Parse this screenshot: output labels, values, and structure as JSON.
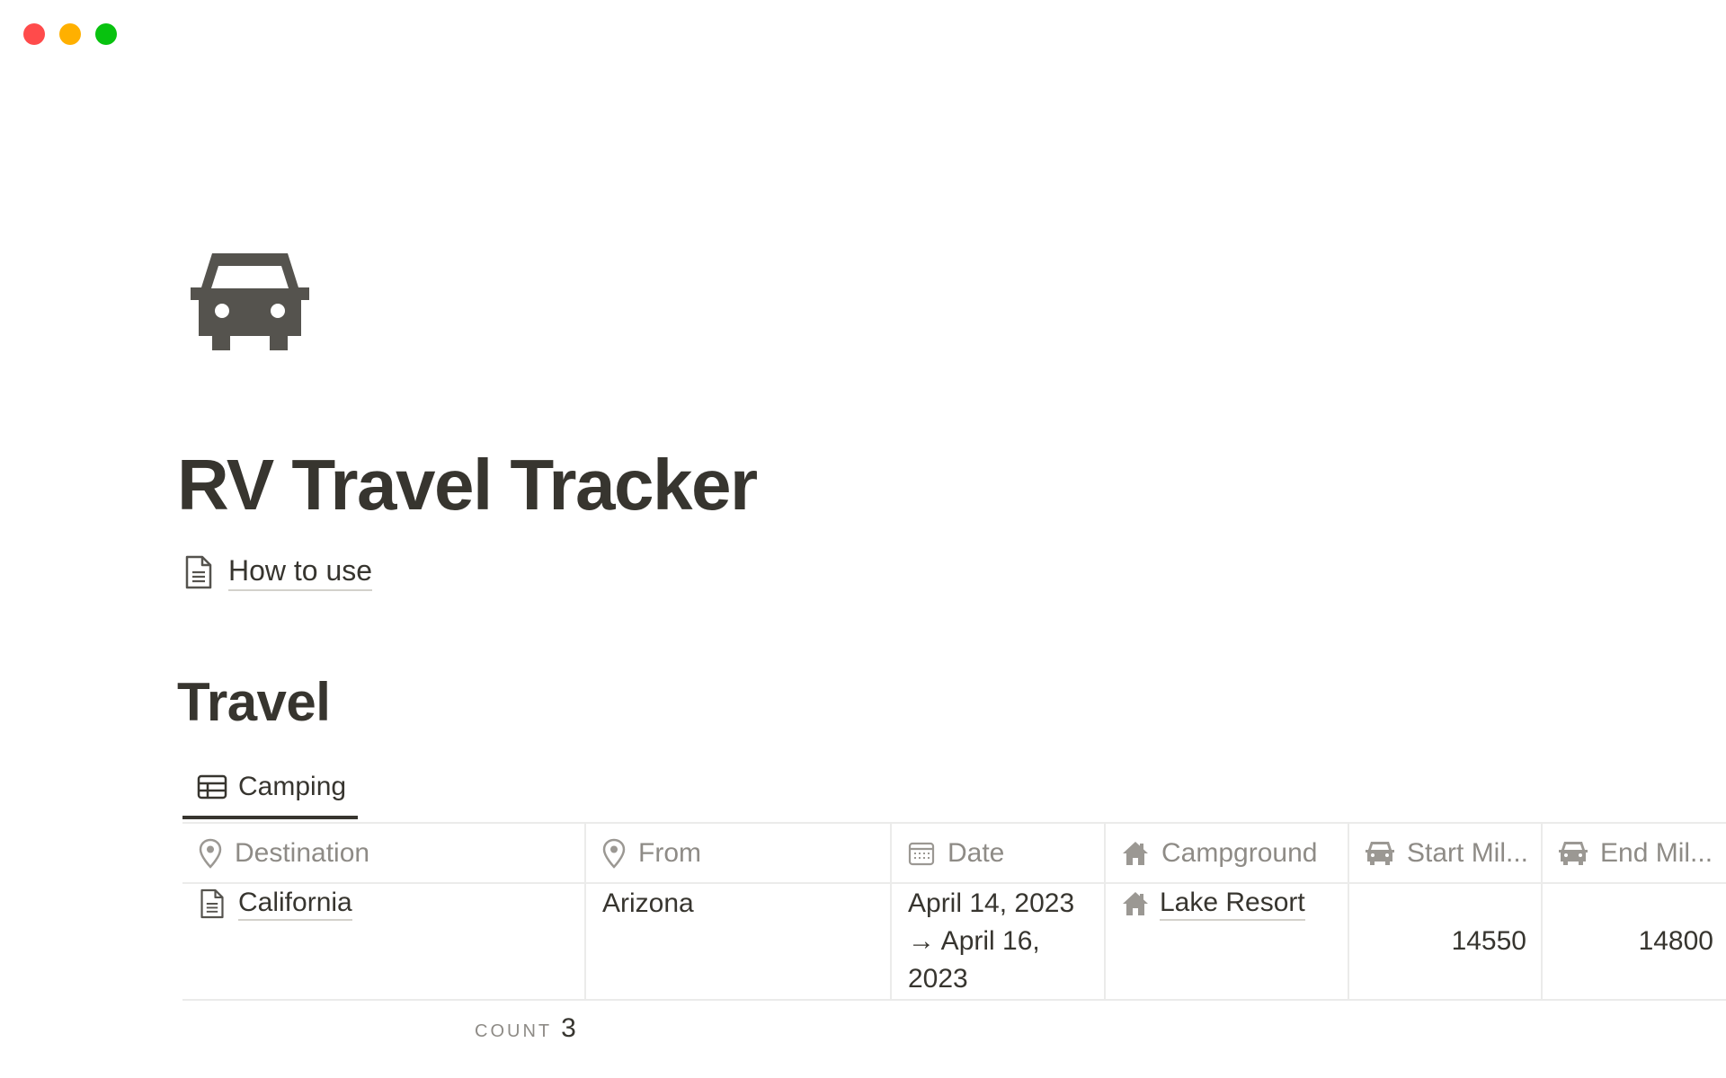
{
  "page": {
    "title": "RV Travel Tracker",
    "icon": "car-icon",
    "link": {
      "label": "How to use",
      "icon": "document-icon"
    }
  },
  "section": {
    "heading": "Travel"
  },
  "view_tab": {
    "label": "Camping",
    "icon": "table-icon"
  },
  "table": {
    "columns": [
      {
        "label": "Destination",
        "icon": "location-pin-icon"
      },
      {
        "label": "From",
        "icon": "location-pin-icon"
      },
      {
        "label": "Date",
        "icon": "calendar-icon"
      },
      {
        "label": "Campground",
        "icon": "house-icon"
      },
      {
        "label": "Start Mil...",
        "icon": "car-icon"
      },
      {
        "label": "End Mil...",
        "icon": "car-icon"
      }
    ],
    "rows": [
      {
        "destination": "California",
        "from": "Arizona",
        "date_line1": "April 14, 2023",
        "date_line2": "→ April 16,",
        "date_line3": "2023",
        "campground": "Lake Resort",
        "start_mileage": "14550",
        "end_mileage": "14800"
      }
    ],
    "footer": {
      "count_label": "COUNT",
      "count_value": "3"
    }
  },
  "colors": {
    "text": "#37352f",
    "muted": "#8e8b86",
    "divider": "#ebebea",
    "traffic_red": "#ff4b4b",
    "traffic_yellow": "#ffb000",
    "traffic_green": "#08c20f"
  }
}
